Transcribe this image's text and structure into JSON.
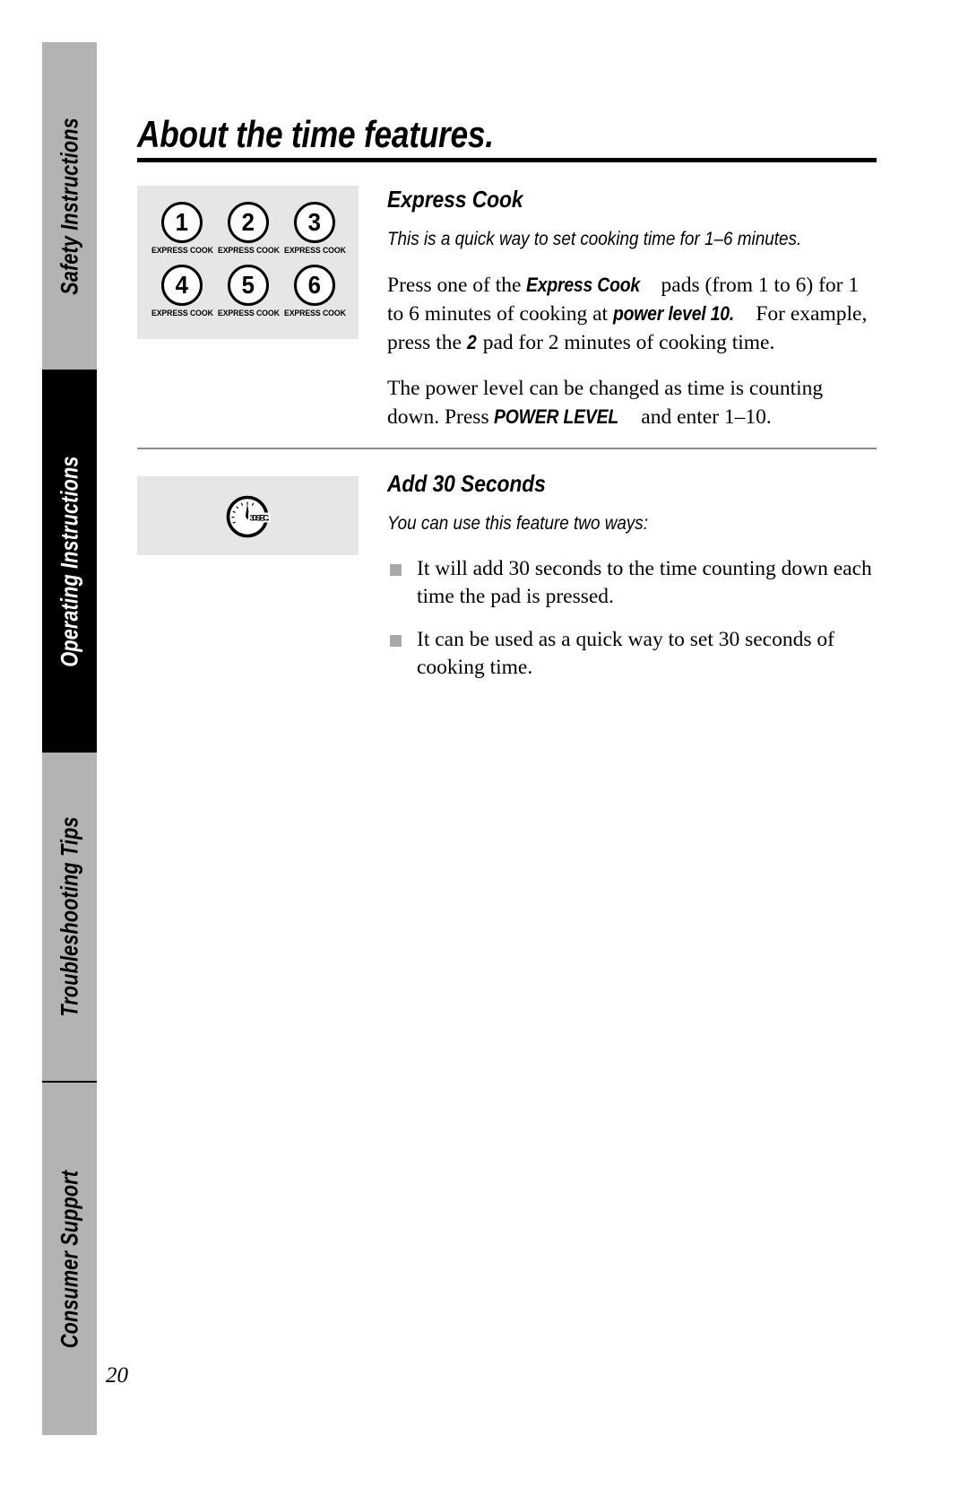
{
  "document": {
    "page_title": "About the time features.",
    "folio": "20"
  },
  "sidebar": {
    "tabs": [
      {
        "label": "Safety Instructions",
        "active": false
      },
      {
        "label": "Operating Instructions",
        "active": true
      },
      {
        "label": "Troubleshooting Tips",
        "active": false
      },
      {
        "label": "Consumer Support",
        "active": false
      }
    ]
  },
  "sections": [
    {
      "id": "express-cook",
      "heading": "Express Cook",
      "subtitle": "This is a quick way to set cooking time for 1–6 minutes.",
      "keypad": {
        "keys": [
          {
            "number": "1",
            "label": "EXPRESS COOK"
          },
          {
            "number": "2",
            "label": "EXPRESS COOK"
          },
          {
            "number": "3",
            "label": "EXPRESS COOK"
          },
          {
            "number": "4",
            "label": "EXPRESS COOK"
          },
          {
            "number": "5",
            "label": "EXPRESS COOK"
          },
          {
            "number": "6",
            "label": "EXPRESS COOK"
          }
        ]
      },
      "paragraph_1": {
        "part_1": "Press one of the ",
        "emphasis_1": "Express Cook",
        "part_2": " pads (from 1 to 6) for 1 to 6 minutes of cooking at ",
        "emphasis_2": "power level 10.",
        "part_3": " For example, press the ",
        "emphasis_3": "2",
        "part_4": " pad for 2 minutes of cooking time."
      },
      "paragraph_2": {
        "part_1": "The power level can be changed as time is counting down. Press ",
        "emphasis_1": "POWER LEVEL",
        "part_2": " and enter 1–10."
      }
    },
    {
      "id": "add-30-seconds",
      "heading": "Add 30 Seconds",
      "subtitle": "You can use this feature two ways:",
      "icon_label": "30 SEC.",
      "bullets": [
        "It will add 30 seconds to the time counting down each time the pad is pressed.",
        "It can be used as a quick way to set 30 seconds of cooking time."
      ]
    }
  ]
}
